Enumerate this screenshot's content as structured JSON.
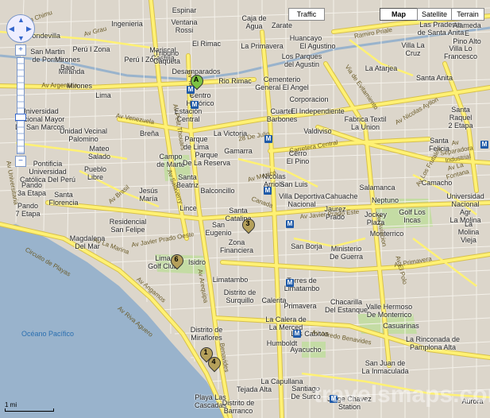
{
  "map_type_buttons": {
    "traffic": "Traffic",
    "map": "Map",
    "satellite": "Satellite",
    "terrain": "Terrain"
  },
  "zoom": {
    "plus": "+",
    "minus": "−"
  },
  "scale_label": "1 mi",
  "watermark": "travelsmaps.com",
  "markers": [
    {
      "id": "A",
      "label": "A",
      "color": "#7dc242"
    },
    {
      "id": "1",
      "label": "1",
      "color": "#b5a05a"
    },
    {
      "id": "3",
      "label": "3",
      "color": "#b5a05a"
    },
    {
      "id": "4",
      "label": "4",
      "color": "#b5a05a"
    },
    {
      "id": "6",
      "label": "6",
      "color": "#b5a05a"
    }
  ],
  "colors": {
    "land": "#dcd6cb",
    "road": "#fff174",
    "road_stroke": "#d7c04a",
    "sea": "#99b3cc",
    "park": "#c4dca4",
    "panel_blue": "#7a96c8"
  },
  "labels": [
    "Espinar",
    "Ventana\nRossi",
    "Caja de\nAgua",
    "Zarate",
    "Las Praderas\nde Santa Anita",
    "Ingenieria",
    "Condevilla",
    "El Rimac",
    "Mariscal\nCastilla",
    "Huancayo",
    "Alameda E\nPino Alto",
    "San Martin\nde Porres",
    "La Primavera",
    "El Agustino",
    "Los Parques\ndel Agustin",
    "Villa La\nCruz",
    "Villa Lo\nFrancesco",
    "Miranda",
    "Perú I Zona",
    "Perú I Zona",
    "Tribuno\nCaqueta",
    "La Atarjea",
    "Mirones\nBajo",
    "Desamparados",
    "Rio Rimac",
    "Cementerio\nGeneral El Angel",
    "Santa Anita",
    "Mirones",
    "Lima",
    "Centro\nHistórico",
    "Corporacion",
    "Santa Raquel\n2 Etapa",
    "Universidad\nNacional Mayor\nDe San Marcos",
    "Estación\nCentral",
    "Cuartel\nBarbones",
    "El Independiente",
    "Fabrica Textil\nLa Union",
    "Unidad Vecinal\nPalomino",
    "Breña",
    "Gamarra",
    "Valdiviso",
    "Santa\nFelicia",
    "Parque\nde Lima",
    "La Victoria",
    "Mateo\nSalado",
    "Campo\nde Marte",
    "Parque\nDe La Reserva",
    "Cerro\nEl Pino",
    "Pontificia\nUniversidad\nCatólica Del Perú",
    "Pueblo\nLibre",
    "Santa\nBeatriz",
    "Nicolas\nArriola",
    "San Luis",
    "Camacho",
    "Pando\n3a Etapa",
    "Jesús\nMaría",
    "Balconcillo",
    "Villa Deportiva\nNacional",
    "Cahuache",
    "Universidad\nNacional Agr\nLa Molina",
    "Pando\n7 Etapa",
    "Santa\nFlorencia",
    "Salamanca",
    "Neptuno",
    "Lince",
    "Santa\nCatalina",
    "Jockey\nPlaza",
    "Golf Los\nIncas",
    "Residencial\nSan Felipe",
    "Jaurez\nPrado",
    "La Molina\nVieja",
    "Magdalena\nDel Mar",
    "San\nEugenio",
    "Monterrico",
    "Zona\nFinanciera",
    "San Borja",
    "Lima\nGolf Club",
    "Isidro",
    "Ministerio\nDe Guerra",
    "Limatambo",
    "Torres de\nLimatambo",
    "Distrito de\nSurquillo",
    "Calerita",
    "Chacarilla\nDel Estanque",
    "Valle Hermoso\nDe Monterrico",
    "Primavera",
    "La Calera de\nLa Merced",
    "Casuarinas",
    "Distrito de\nMiraflores",
    "Humboldt",
    "La Rinconada de\nPamplona Alta",
    "Los Cabitos",
    "Ayacucho",
    "San Juan de\nLa Inmaculada",
    "La Capullana",
    "Tejada Alta",
    "Santiago\nDe Surco",
    "Playa Las\nCascadas",
    "Jorge Chavez\nStation",
    "Distrito de\nBarranco",
    "Aurora"
  ],
  "road_labels": [
    "Av Gran Chimu",
    "Av Grau",
    "Av Argentina",
    "Av Venezuela",
    "28 De Julio",
    "Av Mexico",
    "Carretera Central",
    "Av Nicolas Ayllon",
    "Av Javier Prado Oeste",
    "Av Javier Prado Este",
    "Av Aviacion",
    "Circuito de Playas",
    "Av Alfredo Benavides",
    "Via de Evitamiento",
    "Av Primavera",
    "Av El Polo",
    "Av La Fontana",
    "Av Brasil",
    "Av Arequipa",
    "Av Tacna",
    "Av Angamos",
    "Av La Marina",
    "Av Universitaria",
    "Av Salaverry",
    "Av Petit Thouars",
    "Ramiro Priale",
    "Av Separadora Industrial",
    "Av Los Frutales",
    "Av Riva Aguero",
    "Canada",
    "Benavides"
  ],
  "sea_label": "Océano Pacífico"
}
